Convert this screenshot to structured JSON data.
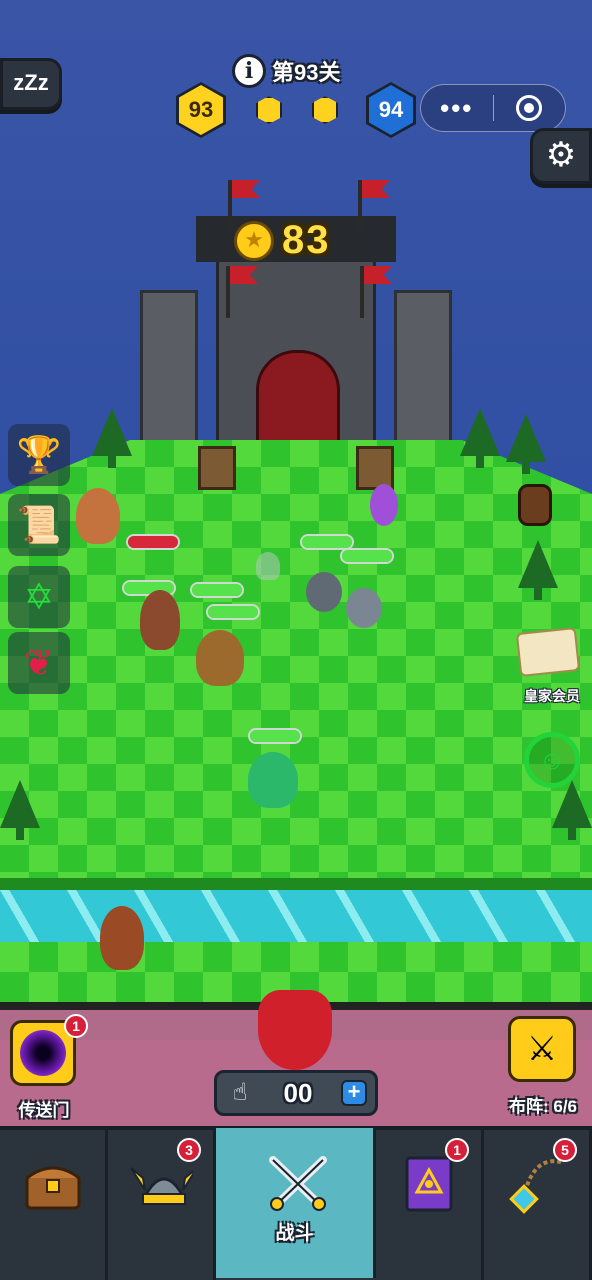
{
  "hud": {
    "sleep_label": "zZz",
    "level_title": "第93关",
    "current_level": "93",
    "next_level": "94",
    "capsule_more": "•••"
  },
  "castle": {
    "coins": "83"
  },
  "side_panel": {
    "royal_label": "皇家会员",
    "emote_label": "☺"
  },
  "bench": {
    "portal_label": "传送门",
    "portal_badge": "1",
    "lineup_label": "布阵: 6/6",
    "summon_count": "00",
    "plus_label": "+"
  },
  "nav": {
    "tabs": [
      {
        "icon": "treasure-chest-icon",
        "label": "",
        "badge": ""
      },
      {
        "icon": "viking-helmet-icon",
        "label": "",
        "badge": "3"
      },
      {
        "icon": "crossed-swords-icon",
        "label": "战斗",
        "badge": ""
      },
      {
        "icon": "spellbook-icon",
        "label": "",
        "badge": "1"
      },
      {
        "icon": "amulet-icon",
        "label": "",
        "badge": "5"
      }
    ]
  },
  "colors": {
    "grass_light": "#53d93c",
    "grass_dark": "#2fc42d",
    "hp_green": "#55e24b",
    "hp_red": "#d6283a",
    "gold": "#ffcc1a",
    "river": "#32c8d6",
    "nav_active": "#5bb8c2"
  },
  "health_bars": [
    {
      "team": "enemy",
      "fill": 1.0
    },
    {
      "team": "ally",
      "fill": 1.0
    },
    {
      "team": "ally",
      "fill": 1.0
    },
    {
      "team": "ally",
      "fill": 1.0
    },
    {
      "team": "ally",
      "fill": 1.0
    },
    {
      "team": "ally",
      "fill": 1.0
    },
    {
      "team": "ally",
      "fill": 1.0
    }
  ]
}
